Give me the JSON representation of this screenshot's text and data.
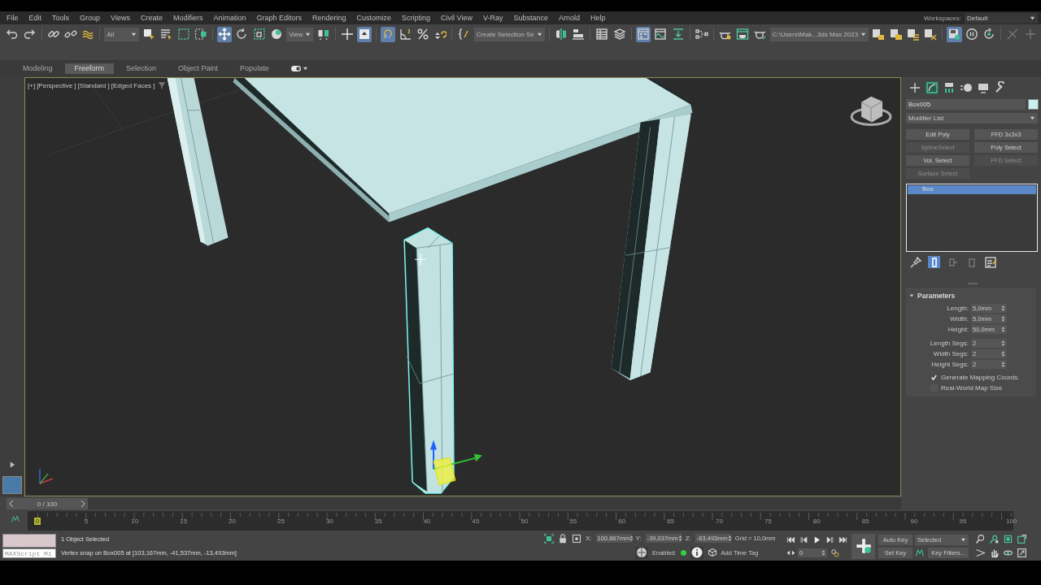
{
  "menu_bar": {
    "items": [
      "File",
      "Edit",
      "Tools",
      "Group",
      "Views",
      "Create",
      "Modifiers",
      "Animation",
      "Graph Editors",
      "Rendering",
      "Customize",
      "Scripting",
      "Civil View",
      "V-Ray",
      "Substance",
      "Arnold",
      "Help"
    ],
    "workspaces": {
      "label": "Workspaces:",
      "value": "Default"
    }
  },
  "toolbar": {
    "items": [
      {
        "kind": "button",
        "selected": false
      },
      {
        "kind": "button",
        "selected": false
      },
      {
        "kind": "separator"
      },
      {
        "kind": "button",
        "selected": false
      },
      {
        "kind": "button",
        "selected": false
      },
      {
        "kind": "button",
        "selected": false
      },
      {
        "kind": "separator"
      },
      {
        "kind": "dropdown",
        "value": "All"
      },
      {
        "kind": "button",
        "selected": false
      },
      {
        "kind": "button",
        "selected": false
      },
      {
        "kind": "button",
        "selected": false
      },
      {
        "kind": "button",
        "selected": false
      },
      {
        "kind": "separator"
      },
      {
        "kind": "button",
        "selected": true
      },
      {
        "kind": "button",
        "selected": false
      },
      {
        "kind": "button",
        "selected": false
      },
      {
        "kind": "button",
        "selected": false
      },
      {
        "kind": "dropdown",
        "value": "View"
      },
      {
        "kind": "button",
        "selected": false
      },
      {
        "kind": "separator"
      },
      {
        "kind": "button",
        "selected": false
      },
      {
        "kind": "button",
        "selected": true
      },
      {
        "kind": "separator"
      },
      {
        "kind": "button",
        "selected": true
      },
      {
        "kind": "button",
        "selected": false
      },
      {
        "kind": "button",
        "selected": false
      },
      {
        "kind": "button",
        "selected": false
      },
      {
        "kind": "separator"
      },
      {
        "kind": "button",
        "selected": false
      },
      {
        "kind": "dropdown",
        "value": "Create Selection Se"
      },
      {
        "kind": "separator"
      },
      {
        "kind": "button",
        "selected": false
      },
      {
        "kind": "button",
        "selected": false
      },
      {
        "kind": "separator"
      },
      {
        "kind": "button",
        "selected": false
      },
      {
        "kind": "button",
        "selected": false
      },
      {
        "kind": "separator"
      },
      {
        "kind": "button",
        "selected": true
      },
      {
        "kind": "button",
        "selected": false
      },
      {
        "kind": "button",
        "selected": false
      },
      {
        "kind": "separator"
      },
      {
        "kind": "button",
        "selected": false
      },
      {
        "kind": "separator"
      },
      {
        "kind": "button",
        "selected": false
      },
      {
        "kind": "button",
        "selected": false
      },
      {
        "kind": "button",
        "selected": false
      },
      {
        "kind": "dropdown",
        "value": "C:\\Users\\Mak...3ds Max 2023"
      },
      {
        "kind": "button",
        "selected": false
      },
      {
        "kind": "button",
        "selected": false
      },
      {
        "kind": "button",
        "selected": false
      },
      {
        "kind": "button",
        "selected": false
      },
      {
        "kind": "separator"
      },
      {
        "kind": "button",
        "selected": true
      },
      {
        "kind": "button",
        "selected": false
      },
      {
        "kind": "button",
        "selected": false
      },
      {
        "kind": "separator"
      },
      {
        "kind": "button",
        "selected": false,
        "disabled": true
      },
      {
        "kind": "button",
        "selected": false,
        "disabled": true
      }
    ]
  },
  "ribbon_tabs": [
    {
      "label": "Modeling",
      "selected": false
    },
    {
      "label": "Freeform",
      "selected": true
    },
    {
      "label": "Selection",
      "selected": false
    },
    {
      "label": "Object Paint",
      "selected": false
    },
    {
      "label": "Populate",
      "selected": false
    }
  ],
  "viewport": {
    "labels": [
      "[+]",
      "[Perspective ]",
      "[Standard ]",
      "[Edged Faces ]"
    ],
    "active": true
  },
  "command_panel": {
    "tabs": [
      {
        "selected": false
      },
      {
        "selected": true
      },
      {
        "selected": false
      },
      {
        "selected": false
      },
      {
        "selected": false
      },
      {
        "selected": false
      }
    ],
    "object_name": "Box005",
    "modifier_list": "Modifier List",
    "modifier_buttons": [
      {
        "label": "Edit Poly",
        "disabled": false
      },
      {
        "label": "FFD 3x3x3",
        "disabled": false
      },
      {
        "label": "SplineSelect",
        "disabled": true
      },
      {
        "label": "Poly Select",
        "disabled": false
      },
      {
        "label": "Vol. Select",
        "disabled": false
      },
      {
        "label": "FFD Select",
        "disabled": true
      },
      {
        "label": "Surface Select",
        "disabled": true
      }
    ],
    "stack": [
      {
        "label": "Box",
        "selected": true
      }
    ],
    "stack_tools": [
      {
        "selected": false
      },
      {
        "selected": true
      },
      {
        "selected": false
      },
      {
        "selected": false
      },
      {
        "selected": false
      }
    ],
    "rollout": {
      "title": "Parameters",
      "expanded": true,
      "groups": [
        [
          {
            "label": "Length:",
            "value": "5,0mm"
          },
          {
            "label": "Width:",
            "value": "5,0mm"
          },
          {
            "label": "Height:",
            "value": "50,0mm"
          }
        ],
        [
          {
            "label": "Length Segs:",
            "value": "2"
          },
          {
            "label": "Width Segs:",
            "value": "2"
          },
          {
            "label": "Height Segs:",
            "value": "2"
          }
        ]
      ],
      "checkboxes": [
        {
          "label": "Generate Mapping Coords.",
          "checked": true
        },
        {
          "label": "Real-World Map Size",
          "checked": false
        }
      ]
    }
  },
  "timeline": {
    "position": "0 / 100",
    "ticks": [
      {
        "label": "0",
        "selected": true
      },
      {
        "label": "5",
        "selected": false
      },
      {
        "label": "10",
        "selected": false
      },
      {
        "label": "15",
        "selected": false
      },
      {
        "label": "20",
        "selected": false
      },
      {
        "label": "25",
        "selected": false
      },
      {
        "label": "30",
        "selected": false
      },
      {
        "label": "35",
        "selected": false
      },
      {
        "label": "40",
        "selected": false
      },
      {
        "label": "45",
        "selected": false
      },
      {
        "label": "50",
        "selected": false
      },
      {
        "label": "55",
        "selected": false
      },
      {
        "label": "60",
        "selected": false
      },
      {
        "label": "65",
        "selected": false
      },
      {
        "label": "70",
        "selected": false
      },
      {
        "label": "75",
        "selected": false
      },
      {
        "label": "80",
        "selected": false
      },
      {
        "label": "85",
        "selected": false
      },
      {
        "label": "90",
        "selected": false
      },
      {
        "label": "95",
        "selected": false
      },
      {
        "label": "100",
        "selected": false
      }
    ]
  },
  "status_bar": {
    "maxscript_placeholder": "MAXScript Mi",
    "selection": "1 Object Selected",
    "prompt": "Vertex snap on Box005 at [103,167mm, -41,537mm, -13,493mm]",
    "coords": [
      {
        "axis": "X:",
        "value": "100,667mm"
      },
      {
        "axis": "Y:",
        "value": "-39,037mm"
      },
      {
        "axis": "Z:",
        "value": "-63,493mm"
      }
    ],
    "grid": "Grid = 10,0mm",
    "enabled_label": "Enabled:",
    "enabled": true,
    "add_time_tag": "Add Time Tag",
    "current_frame": "0",
    "auto_key": "Auto Key",
    "key_set": "Selected",
    "set_key": "Set Key",
    "key_filters": "Key Filters..."
  }
}
